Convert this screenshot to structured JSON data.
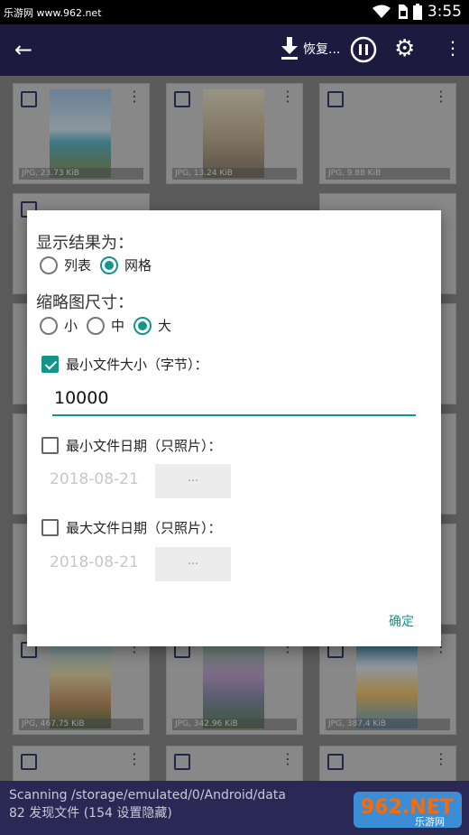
{
  "status": {
    "watermark": "乐游网 www.962.net",
    "time": "3:55"
  },
  "appbar": {
    "restore_label": "恢复..."
  },
  "grid": {
    "captions": [
      "JPG, 23.73 KiB",
      "JPG, 13.24 KiB",
      "JPG, 9.88 KiB",
      "JPG, 467.75 KiB",
      "JPG, 342.96 KiB",
      "JPG, 387.4 KiB"
    ]
  },
  "dialog": {
    "display_as_label": "显示结果为：",
    "display_options": [
      "列表",
      "网格"
    ],
    "display_selected": "网格",
    "thumb_size_label": "缩略图尺寸：",
    "thumb_options": [
      "小",
      "中",
      "大"
    ],
    "thumb_selected": "大",
    "min_size_label": "最小文件大小（字节）：",
    "min_size_checked": true,
    "min_size_value": "10000",
    "min_date_label": "最小文件日期（只照片）：",
    "min_date_checked": false,
    "min_date_value": "2018-08-21",
    "min_date_button": "...",
    "max_date_label": "最大文件日期（只照片）：",
    "max_date_checked": false,
    "max_date_value": "2018-08-21",
    "max_date_button": "...",
    "ok_label": "确定"
  },
  "bottom": {
    "line1": "Scanning /storage/emulated/0/Android/data",
    "line2": "82 发现文件 (154 设置隐藏)",
    "logo_text": "962.NET",
    "logo_sub": "乐游网"
  }
}
